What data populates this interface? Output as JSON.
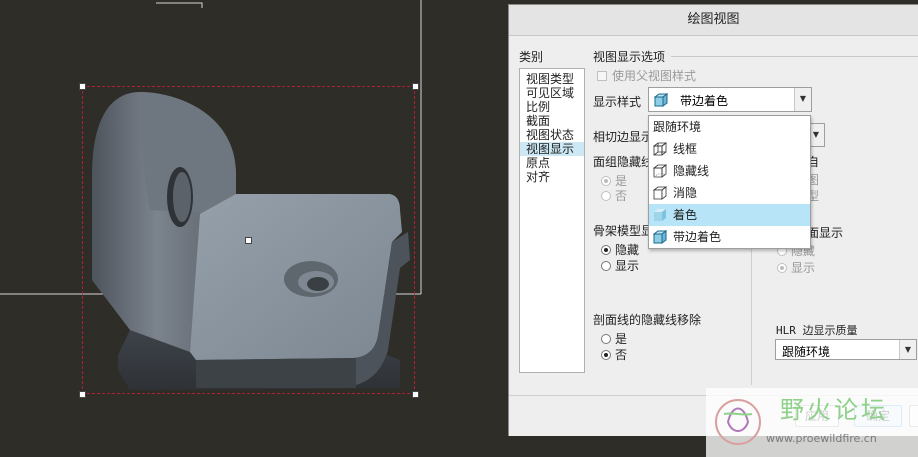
{
  "dialog": {
    "title": "绘图视图",
    "category_label": "类别",
    "categories": [
      "视图类型",
      "可见区域",
      "比例",
      "截面",
      "视图状态",
      "视图显示",
      "原点",
      "对齐"
    ],
    "selected_category": "视图显示",
    "view_display_options_label": "视图显示选项",
    "use_parent_style_label": "使用父视图样式",
    "display_style_label": "显示样式",
    "display_style_value": "带边着色",
    "tangent_edge_label": "相切边显示",
    "face_group_hidden_label": "面组隐藏线",
    "face_group_yes": "是",
    "face_group_no": "否",
    "skeleton_label": "骨架模型显",
    "skeleton_hidden": "隐藏",
    "skeleton_show": "显示",
    "section_hidden_removal_label": "剖面线的隐藏线移除",
    "section_yes": "是",
    "section_no": "否",
    "right_col_auto": "自",
    "right_col_frag1": "图",
    "right_col_frag2": "型",
    "section_display_label": "截面显示",
    "section_display_hidden": "隐藏",
    "section_display_show": "显示",
    "hlr_quality_label": "HLR 边显示质量",
    "hlr_quality_value": "跟随环境",
    "apply_button": "应用",
    "ok_button": "确定"
  },
  "dropdown": {
    "items": [
      "跟随环境",
      "线框",
      "隐藏线",
      "消隐",
      "着色",
      "带边着色"
    ],
    "selected": "着色"
  },
  "watermark": {
    "text": "野火论坛",
    "url": "www.proewildfire.cn"
  },
  "colors": {
    "viewport_bg": "#2f2d28",
    "selection_border": "#b02030",
    "dropdown_highlight": "#b7e4f7",
    "list_highlight": "#cce8f4",
    "watermark_green": "#8fd18a",
    "watermark_gray": "#7a7a7a"
  }
}
